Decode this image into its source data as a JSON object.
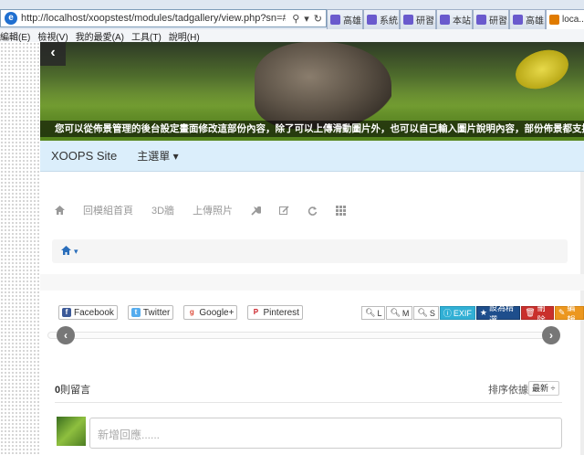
{
  "browser": {
    "url": "http://localhost/xoopstest/modules/tadgallery/view.php?sn=#photo",
    "tabs": [
      "高雄...",
      "系統...",
      "研習...",
      "本站...",
      "研習...",
      "高雄...",
      "loca..."
    ],
    "menu": [
      "編輯(E)",
      "檢視(V)",
      "我的最愛(A)",
      "工具(T)",
      "說明(H)"
    ]
  },
  "banner": {
    "prev_label": "‹",
    "caption": "您可以從佈景管理的後台設定畫面修改這部份內容，除了可以上傳滑動圖片外，也可以自己輸入圖片說明內容，部份佈景都支援HTML語法"
  },
  "navbar": {
    "brand": "XOOPS Site",
    "menu_label": "主選單 ▾"
  },
  "toolbar": {
    "module_home": "回模組首頁",
    "wall_3d": "3D牆",
    "upload": "上傳照片"
  },
  "breadcrumb": {
    "caret": "▾"
  },
  "social": {
    "facebook": "Facebook",
    "twitter": "Twitter",
    "google": "Google+",
    "pinterest": "Pinterest"
  },
  "actions": {
    "size_l": "L",
    "size_m": "M",
    "size_s": "S",
    "exif": "EXIF",
    "featured": "設為精選",
    "delete": "刪除",
    "edit": "編輯"
  },
  "nav_prev": "‹",
  "nav_next": "›",
  "comments": {
    "count_num": "0",
    "count_label": "則留言",
    "sort_label": "排序依據",
    "sort_value": "最新 ÷",
    "placeholder": "新增回應......"
  },
  "colors": {
    "navbar_bg": "#dbeefb",
    "info": "#31b0d5",
    "primary": "#1e4e8c",
    "danger": "#c9302c",
    "warning": "#ec971f"
  }
}
